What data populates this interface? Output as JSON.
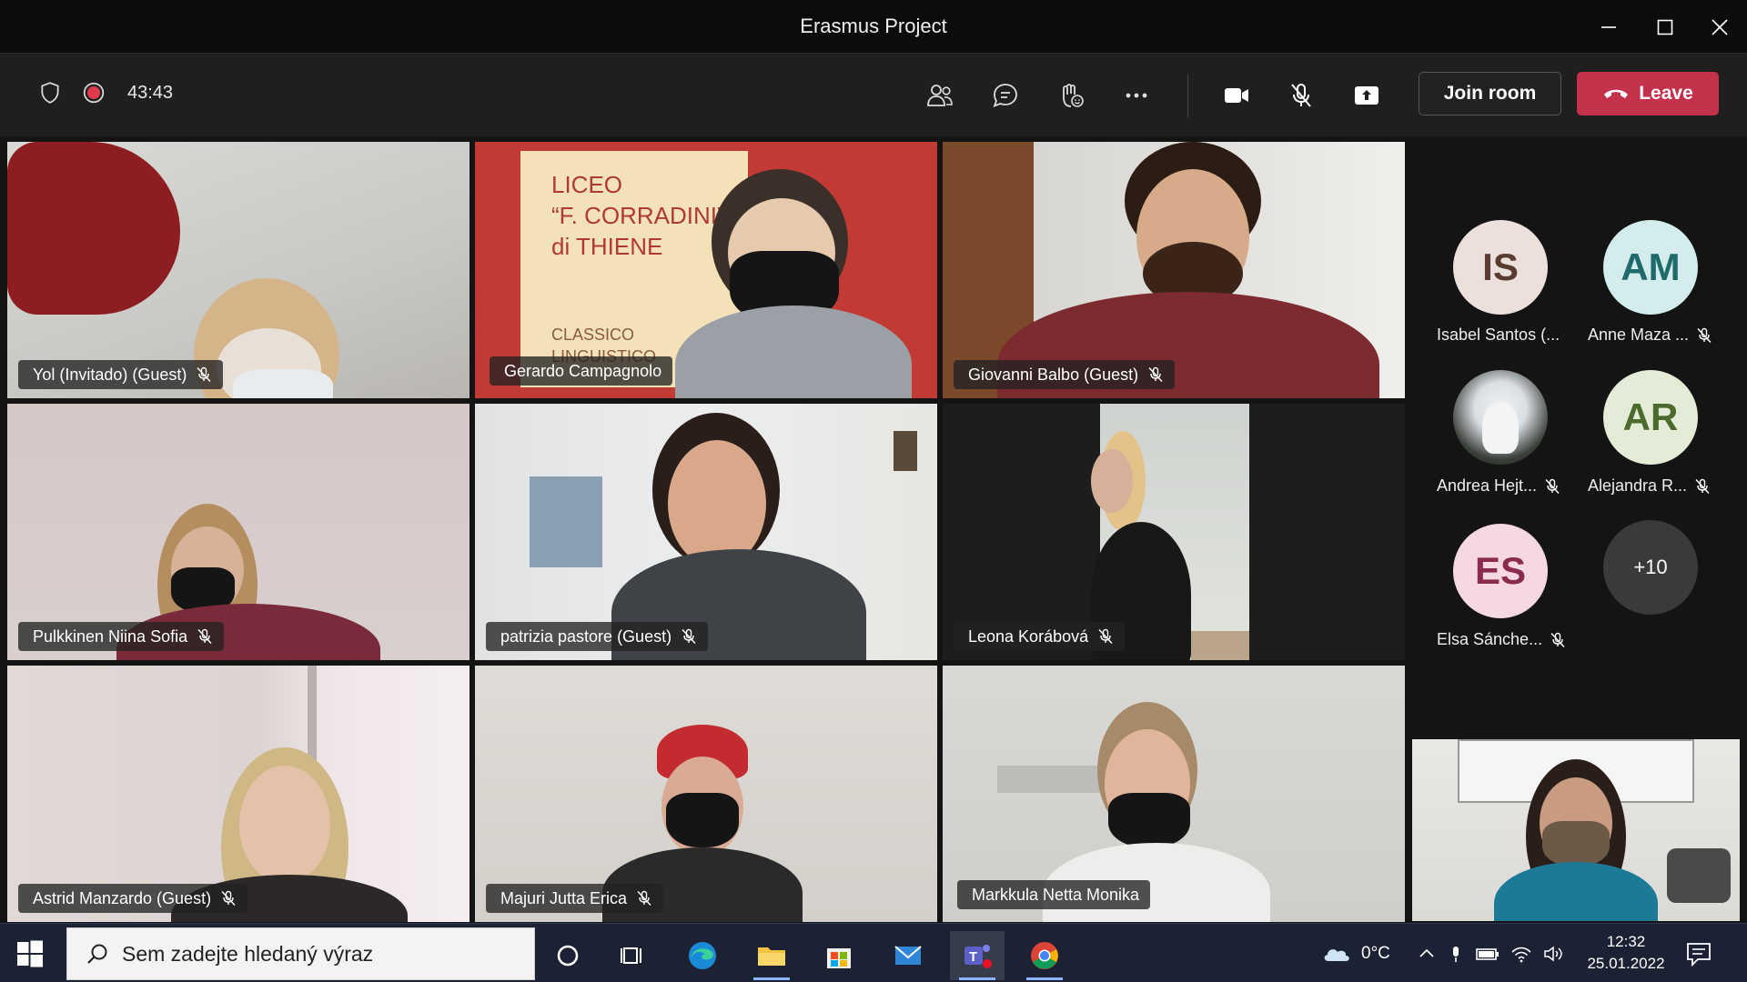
{
  "window": {
    "title": "Erasmus Project"
  },
  "toolbar": {
    "timer": "43:43",
    "join_room_label": "Join room",
    "leave_label": "Leave"
  },
  "tiles": [
    {
      "name": "Yol (Invitado) (Guest)",
      "muted": true
    },
    {
      "name": "Gerardo Campagnolo",
      "muted": false,
      "active": true
    },
    {
      "name": "Giovanni Balbo (Guest)",
      "muted": true
    },
    {
      "name": "Pulkkinen Niina Sofia",
      "muted": true
    },
    {
      "name": "patrizia pastore (Guest)",
      "muted": true
    },
    {
      "name": "Leona Korábová",
      "muted": true
    },
    {
      "name": "Astrid Manzardo (Guest)",
      "muted": true
    },
    {
      "name": "Majuri Jutta Erica",
      "muted": true
    },
    {
      "name": "Markkula Netta Monika",
      "muted": false,
      "active": true
    }
  ],
  "background_sign": {
    "line1": "LICEO",
    "line2": "“F. CORRADINI”",
    "line3": "di THIENE",
    "line4": "CLASSICO",
    "line5": "LINGUISTICO"
  },
  "roster": [
    {
      "initials": "IS",
      "name": "Isabel Santos (...",
      "muted": false,
      "color": "#ebe0dc",
      "text_color": "#5b3b30"
    },
    {
      "initials": "AM",
      "name": "Anne Maza ...",
      "muted": true,
      "color": "#d4ecec",
      "text_color": "#1f6a6a"
    },
    {
      "initials": "",
      "name": "Andrea Hejt...",
      "muted": true,
      "color": "#d9dfe3",
      "text_color": "#333"
    },
    {
      "initials": "AR",
      "name": "Alejandra R...",
      "muted": true,
      "color": "#e4ecd8",
      "text_color": "#4b6a2b"
    },
    {
      "initials": "ES",
      "name": "Elsa Sánche...",
      "muted": true,
      "color": "#f5d8e2",
      "text_color": "#8a2a4f"
    },
    {
      "initials": "+10",
      "name": "",
      "muted": false,
      "color": "#3a3a3a",
      "text_color": "#ffffff"
    }
  ],
  "taskbar": {
    "search_placeholder": "Sem zadejte hledaný výraz",
    "weather": "0°C",
    "time": "12:32",
    "date": "25.01.2022"
  }
}
